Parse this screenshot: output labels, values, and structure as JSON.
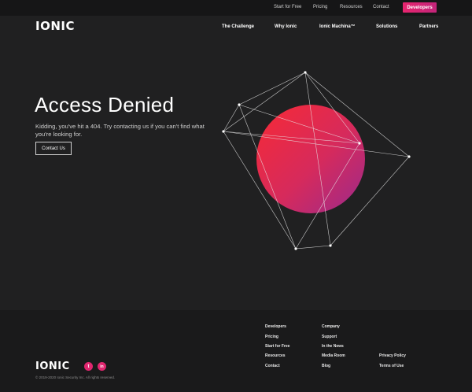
{
  "brand": {
    "logo_text": "IONIC"
  },
  "topbar": {
    "links": [
      "Start for Free",
      "Pricing",
      "Resources",
      "Contact"
    ],
    "developers_button": "Developers"
  },
  "nav": {
    "items": [
      "The Challenge",
      "Why Ionic",
      "Ionic Machina™",
      "Solutions",
      "Partners"
    ]
  },
  "hero": {
    "title": "Access Denied",
    "subtitle": "Kidding, you've hit a 404. Try contacting us if you can't find what you're looking for.",
    "cta": "Contact Us"
  },
  "colors": {
    "accent_start": "#f0293e",
    "accent_end": "#a82a86"
  },
  "footer": {
    "col1": [
      "Developers",
      "Pricing",
      "Start for Free",
      "Resources",
      "Contact"
    ],
    "col2": [
      "Company",
      "Support",
      "In the News",
      "Media Room",
      "Blog"
    ],
    "col3": [
      "Privacy Policy",
      "Terms of Use"
    ],
    "social": [
      {
        "icon": "twitter-icon",
        "glyph": "t"
      },
      {
        "icon": "linkedin-icon",
        "glyph": "in"
      }
    ],
    "copyright": "© 2019-2020 Ionic Security Inc. All rights reserved."
  }
}
